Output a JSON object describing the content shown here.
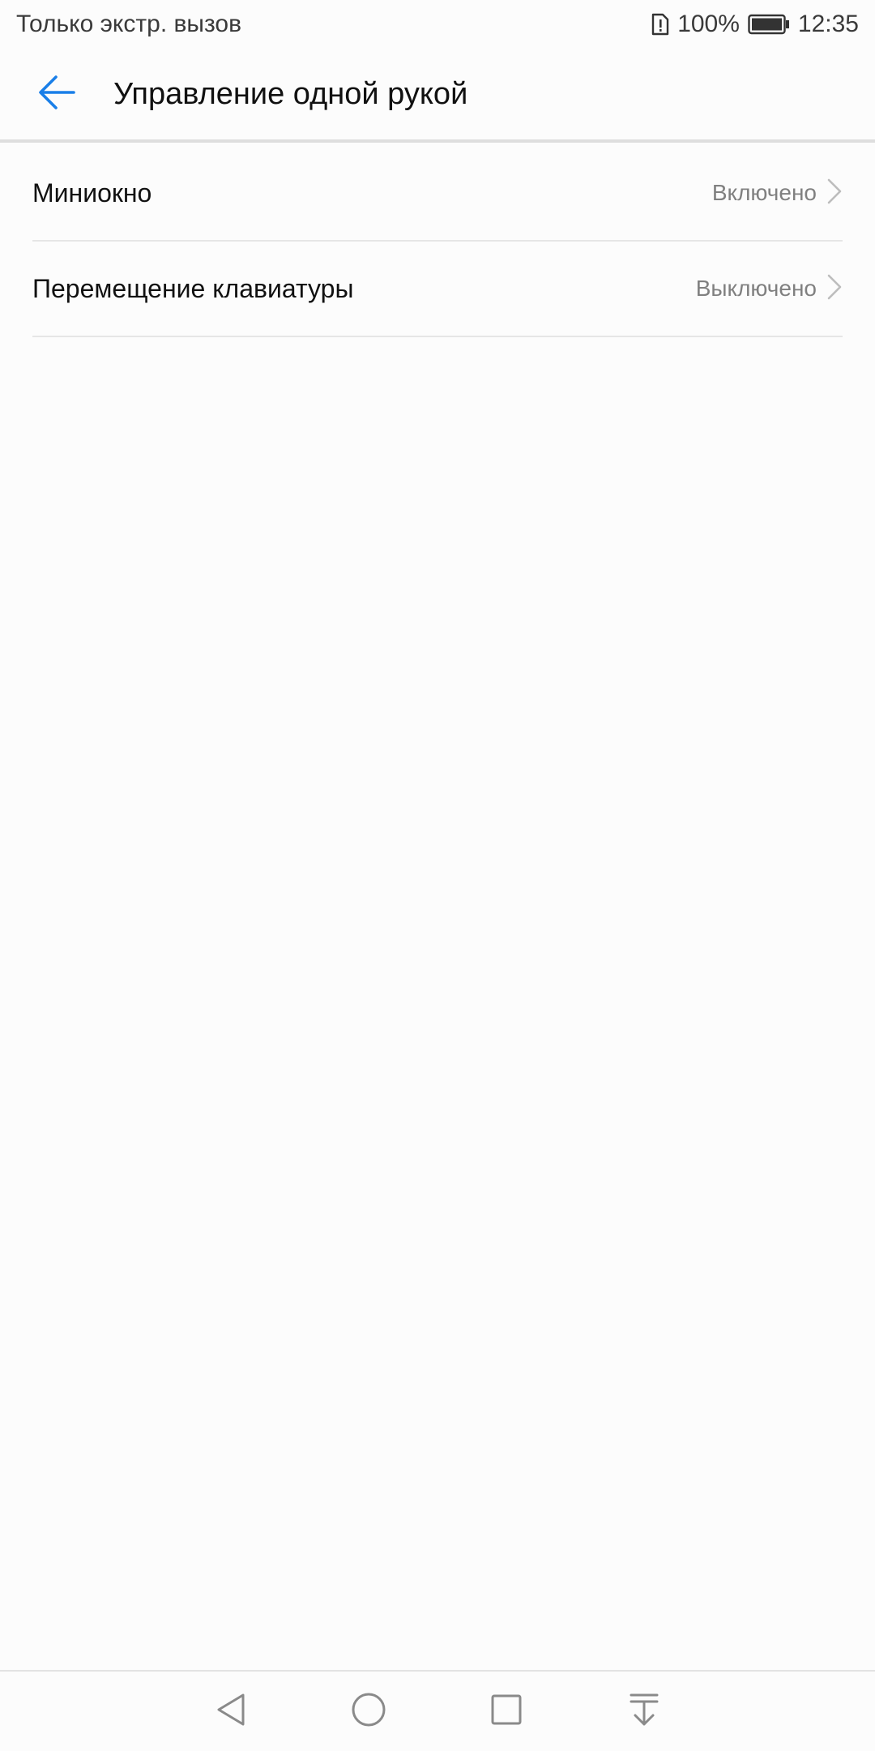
{
  "status_bar": {
    "carrier_text": "Только экстр. вызов",
    "battery_percent": "100%",
    "time": "12:35"
  },
  "app_bar": {
    "title": "Управление одной рукой",
    "accent_color": "#1a7fe8"
  },
  "settings": [
    {
      "label": "Миниокно",
      "value": "Включено"
    },
    {
      "label": "Перемещение клавиатуры",
      "value": "Выключено"
    }
  ],
  "icons": {
    "back": "arrow-left-icon",
    "chevron": "chevron-right-icon",
    "sim_alert": "sim-alert-icon",
    "battery": "battery-full-icon",
    "nav_back": "triangle-back-icon",
    "nav_home": "circle-home-icon",
    "nav_recents": "square-recents-icon",
    "nav_notifications": "pull-down-notifications-icon"
  }
}
